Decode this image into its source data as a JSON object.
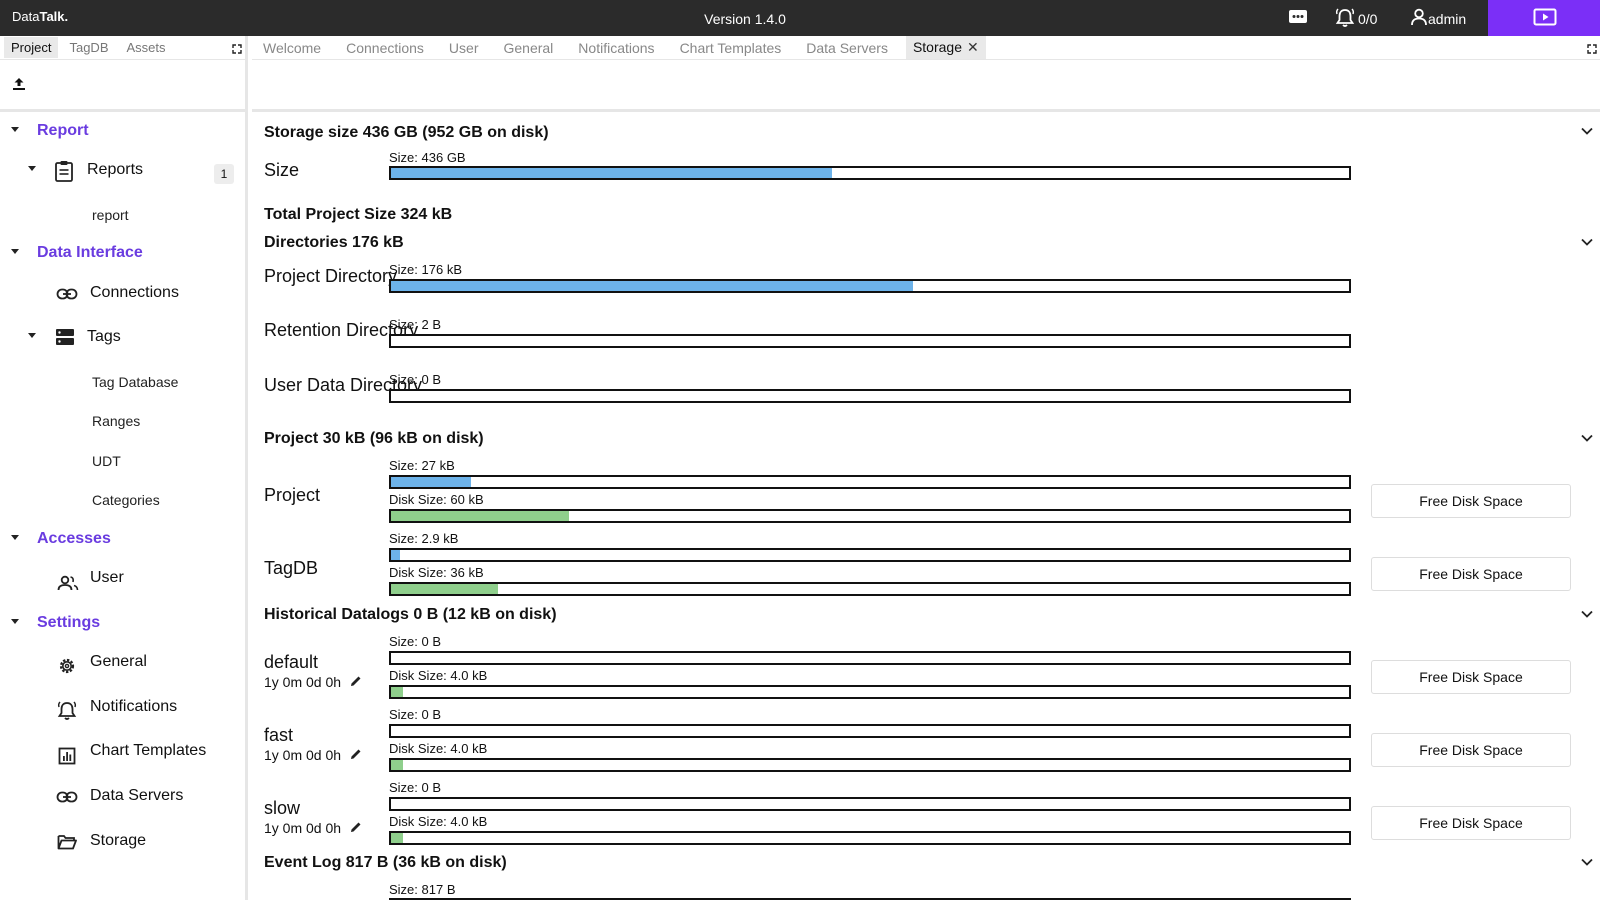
{
  "app": {
    "brand_prefix": "Data",
    "brand_bold": "Talk.",
    "version": "Version 1.4.0",
    "alarm_count": "0/0",
    "user": "admin"
  },
  "left_tabs": [
    "Project",
    "TagDB",
    "Assets"
  ],
  "left_tab_active": "Project",
  "tree": {
    "report_section": "Report",
    "reports_label": "Reports",
    "reports_badge": "1",
    "report_item": "report",
    "data_interface_section": "Data Interface",
    "connections": "Connections",
    "tags": "Tags",
    "tag_database": "Tag Database",
    "ranges": "Ranges",
    "udt": "UDT",
    "categories": "Categories",
    "accesses_section": "Accesses",
    "user": "User",
    "settings_section": "Settings",
    "general": "General",
    "notifications": "Notifications",
    "chart_templates": "Chart Templates",
    "data_servers": "Data Servers",
    "storage": "Storage"
  },
  "right_tabs": [
    "Welcome",
    "Connections",
    "User",
    "General",
    "Notifications",
    "Chart Templates",
    "Data Servers",
    "Storage"
  ],
  "right_tab_active": "Storage",
  "storage": {
    "storage_size": {
      "title": "Storage size 436 GB (952 GB on disk)",
      "row_label": "Size",
      "bar_label": "Size: 436 GB",
      "fill": 0.46
    },
    "total_project_size": "Total Project Size 324 kB",
    "directories": {
      "title": "Directories 176 kB",
      "rows": [
        {
          "label": "Project Directory",
          "bar_label": "Size: 176 kB",
          "fill": 0.545
        },
        {
          "label": "Retention Directory",
          "bar_label": "Size: 2 B",
          "fill": 0.0
        },
        {
          "label": "User Data Directory",
          "bar_label": "Size: 0 B",
          "fill": 0.0
        }
      ]
    },
    "project": {
      "title": "Project 30 kB (96 kB on disk)",
      "rows": [
        {
          "label": "Project",
          "size_label": "Size: 27 kB",
          "size_fill": 0.083,
          "disk_label": "Disk Size: 60 kB",
          "disk_fill": 0.186,
          "button": "Free Disk Space"
        },
        {
          "label": "TagDB",
          "size_label": "Size: 2.9 kB",
          "size_fill": 0.009,
          "disk_label": "Disk Size: 36 kB",
          "disk_fill": 0.112,
          "button": "Free Disk Space"
        }
      ]
    },
    "historical_datalogs": {
      "title": "Historical Datalogs 0 B (12 kB on disk)",
      "rows": [
        {
          "label": "default",
          "retention": "1y 0m 0d 0h",
          "size_label": "Size: 0 B",
          "size_fill": 0.0,
          "disk_label": "Disk Size: 4.0 kB",
          "disk_fill": 0.013,
          "button": "Free Disk Space"
        },
        {
          "label": "fast",
          "retention": "1y 0m 0d 0h",
          "size_label": "Size: 0 B",
          "size_fill": 0.0,
          "disk_label": "Disk Size: 4.0 kB",
          "disk_fill": 0.013,
          "button": "Free Disk Space"
        },
        {
          "label": "slow",
          "retention": "1y 0m 0d 0h",
          "size_label": "Size: 0 B",
          "size_fill": 0.0,
          "disk_label": "Disk Size: 4.0 kB",
          "disk_fill": 0.013,
          "button": "Free Disk Space"
        }
      ]
    },
    "event_log": {
      "title": "Event Log 817 B (36 kB on disk)",
      "size_label": "Size: 817 B"
    }
  },
  "colors": {
    "accent": "#6a3ce0",
    "present_button": "#7b2ff7",
    "topbar": "#2b2b2b",
    "size_fill": "#6db3ea",
    "disk_fill": "#8fcf8c"
  }
}
